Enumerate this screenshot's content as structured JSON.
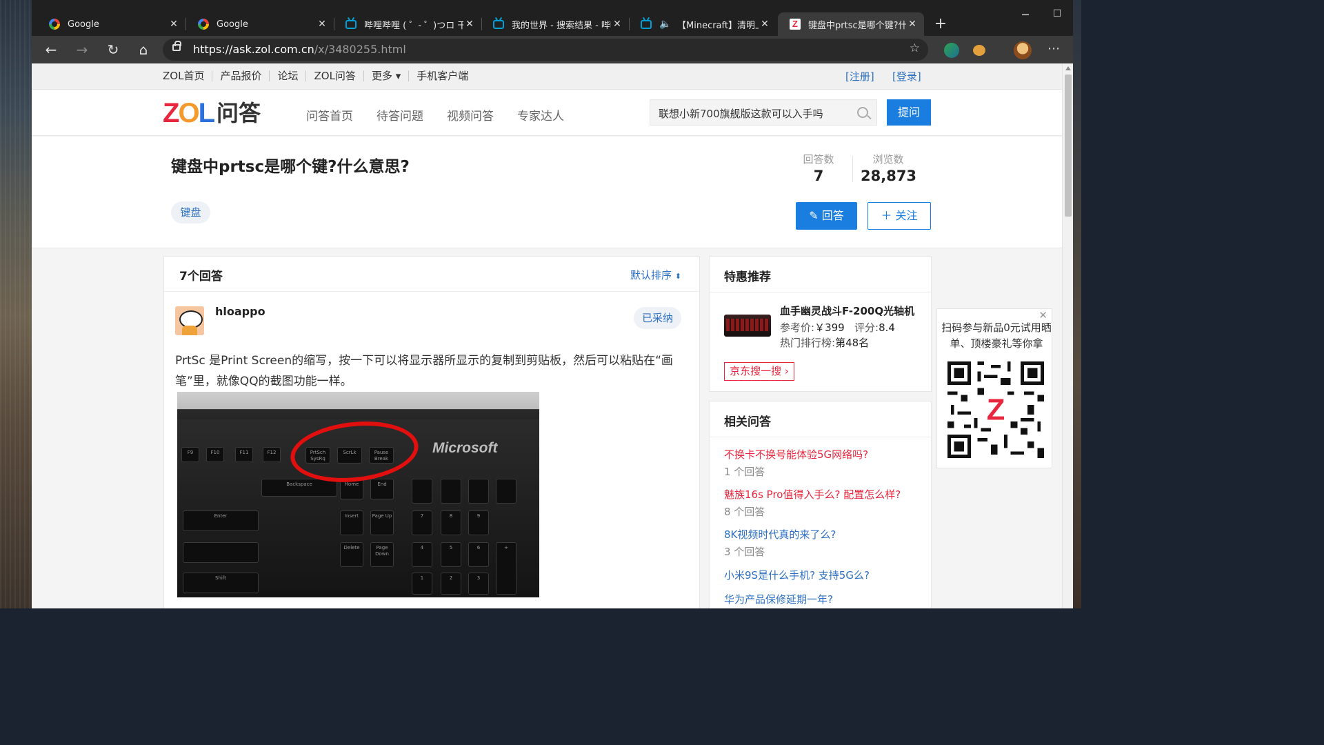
{
  "browser": {
    "tabs": [
      {
        "title": "Google",
        "icon": "google-icon"
      },
      {
        "title": "Google",
        "icon": "google-icon"
      },
      {
        "title": "哔哩哔哩 ( ゜- ゜)つロ 干杯~",
        "icon": "bilibili-icon"
      },
      {
        "title": "我的世界 - 搜索结果 - 哔哩",
        "icon": "bilibili-icon"
      },
      {
        "title": "【Minecraft】清明上河",
        "icon": "bilibili-icon"
      },
      {
        "title": "键盘中prtsc是哪个键?什么意",
        "icon": "zol-icon"
      }
    ],
    "url_host": "https://ask.zol.com.cn",
    "url_path": "/x/3480255.html"
  },
  "topbar": {
    "links": [
      "ZOL首页",
      "产品报价",
      "论坛",
      "ZOL问答",
      "更多 ▾",
      "手机客户端"
    ],
    "register": "[注册]",
    "login": "[登录]"
  },
  "header": {
    "logo_zol": "ZOL",
    "logo_text": "问答",
    "nav": [
      "问答首页",
      "待答问题",
      "视频问答",
      "专家达人"
    ],
    "search_value": "联想小新700旗舰版这款可以入手吗",
    "ask_button": "提问"
  },
  "question": {
    "title": "键盘中prtsc是哪个键?什么意思?",
    "answers_label": "回答数",
    "answers_count": "7",
    "views_label": "浏览数",
    "views_count": "28,873",
    "tag": "键盘",
    "answer_button": "回答",
    "follow_button": "关注"
  },
  "answers": {
    "header": "7个回答",
    "sort": "默认排序",
    "first": {
      "user": "hloappo",
      "badge": "已采纳",
      "text": "PrtSc 是Print Screen的缩写，按一下可以将显示器所显示的复制到剪贴板，然后可以粘贴在“画笔”里，就像QQ的截图功能一样。",
      "image_brand": "Microsoft"
    }
  },
  "deal": {
    "header": "特惠推荐",
    "product": "血手幽灵战斗F-200Q光轴机",
    "price_label": "参考价:",
    "price": "￥399",
    "score_label": "评分:",
    "score": "8.4",
    "rank_label": "热门排行榜:",
    "rank": "第48名",
    "jd_button": "京东搜一搜"
  },
  "related": {
    "header": "相关问答",
    "items": [
      {
        "title": "不换卡不换号能体验5G网络吗?",
        "count": "1 个回答",
        "color": "#e8263d"
      },
      {
        "title": "魅族16s Pro值得入手么? 配置怎么样?",
        "count": "8 个回答",
        "color": "#e8263d"
      },
      {
        "title": "8K视频时代真的来了么?",
        "count": "3 个回答",
        "color": "#2d6fc1"
      },
      {
        "title": "小米9S是什么手机? 支持5G么?",
        "count": "",
        "color": "#2d6fc1"
      },
      {
        "title": "华为产品保修延期一年?",
        "count": "",
        "color": "#2d6fc1"
      }
    ]
  },
  "qr_popup": {
    "text": "扫码参与新品0元试用晒单、顶楼豪礼等你拿"
  },
  "colors": {
    "accent": "#1a7ee0",
    "link": "#2d6fc1",
    "red": "#e8263d"
  }
}
